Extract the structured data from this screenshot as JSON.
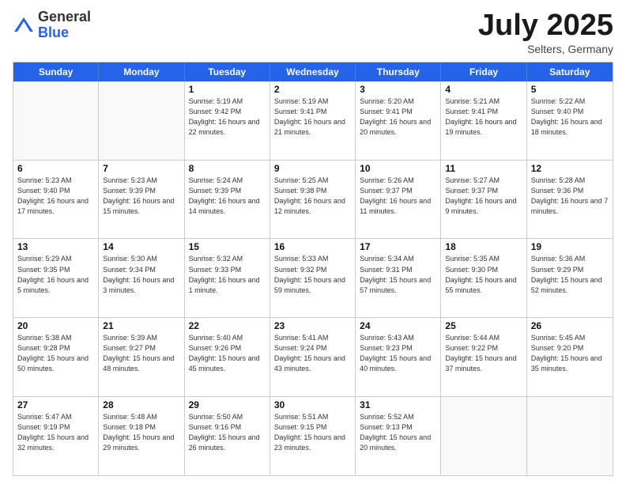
{
  "header": {
    "logo": {
      "general": "General",
      "blue": "Blue"
    },
    "title": "July 2025",
    "location": "Selters, Germany"
  },
  "days_of_week": [
    "Sunday",
    "Monday",
    "Tuesday",
    "Wednesday",
    "Thursday",
    "Friday",
    "Saturday"
  ],
  "weeks": [
    [
      {
        "day": null
      },
      {
        "day": null
      },
      {
        "day": "1",
        "sunrise": "5:19 AM",
        "sunset": "9:42 PM",
        "daylight": "16 hours and 22 minutes."
      },
      {
        "day": "2",
        "sunrise": "5:19 AM",
        "sunset": "9:41 PM",
        "daylight": "16 hours and 21 minutes."
      },
      {
        "day": "3",
        "sunrise": "5:20 AM",
        "sunset": "9:41 PM",
        "daylight": "16 hours and 20 minutes."
      },
      {
        "day": "4",
        "sunrise": "5:21 AM",
        "sunset": "9:41 PM",
        "daylight": "16 hours and 19 minutes."
      },
      {
        "day": "5",
        "sunrise": "5:22 AM",
        "sunset": "9:40 PM",
        "daylight": "16 hours and 18 minutes."
      }
    ],
    [
      {
        "day": "6",
        "sunrise": "5:23 AM",
        "sunset": "9:40 PM",
        "daylight": "16 hours and 17 minutes."
      },
      {
        "day": "7",
        "sunrise": "5:23 AM",
        "sunset": "9:39 PM",
        "daylight": "16 hours and 15 minutes."
      },
      {
        "day": "8",
        "sunrise": "5:24 AM",
        "sunset": "9:39 PM",
        "daylight": "16 hours and 14 minutes."
      },
      {
        "day": "9",
        "sunrise": "5:25 AM",
        "sunset": "9:38 PM",
        "daylight": "16 hours and 12 minutes."
      },
      {
        "day": "10",
        "sunrise": "5:26 AM",
        "sunset": "9:37 PM",
        "daylight": "16 hours and 11 minutes."
      },
      {
        "day": "11",
        "sunrise": "5:27 AM",
        "sunset": "9:37 PM",
        "daylight": "16 hours and 9 minutes."
      },
      {
        "day": "12",
        "sunrise": "5:28 AM",
        "sunset": "9:36 PM",
        "daylight": "16 hours and 7 minutes."
      }
    ],
    [
      {
        "day": "13",
        "sunrise": "5:29 AM",
        "sunset": "9:35 PM",
        "daylight": "16 hours and 5 minutes."
      },
      {
        "day": "14",
        "sunrise": "5:30 AM",
        "sunset": "9:34 PM",
        "daylight": "16 hours and 3 minutes."
      },
      {
        "day": "15",
        "sunrise": "5:32 AM",
        "sunset": "9:33 PM",
        "daylight": "16 hours and 1 minute."
      },
      {
        "day": "16",
        "sunrise": "5:33 AM",
        "sunset": "9:32 PM",
        "daylight": "15 hours and 59 minutes."
      },
      {
        "day": "17",
        "sunrise": "5:34 AM",
        "sunset": "9:31 PM",
        "daylight": "15 hours and 57 minutes."
      },
      {
        "day": "18",
        "sunrise": "5:35 AM",
        "sunset": "9:30 PM",
        "daylight": "15 hours and 55 minutes."
      },
      {
        "day": "19",
        "sunrise": "5:36 AM",
        "sunset": "9:29 PM",
        "daylight": "15 hours and 52 minutes."
      }
    ],
    [
      {
        "day": "20",
        "sunrise": "5:38 AM",
        "sunset": "9:28 PM",
        "daylight": "15 hours and 50 minutes."
      },
      {
        "day": "21",
        "sunrise": "5:39 AM",
        "sunset": "9:27 PM",
        "daylight": "15 hours and 48 minutes."
      },
      {
        "day": "22",
        "sunrise": "5:40 AM",
        "sunset": "9:26 PM",
        "daylight": "15 hours and 45 minutes."
      },
      {
        "day": "23",
        "sunrise": "5:41 AM",
        "sunset": "9:24 PM",
        "daylight": "15 hours and 43 minutes."
      },
      {
        "day": "24",
        "sunrise": "5:43 AM",
        "sunset": "9:23 PM",
        "daylight": "15 hours and 40 minutes."
      },
      {
        "day": "25",
        "sunrise": "5:44 AM",
        "sunset": "9:22 PM",
        "daylight": "15 hours and 37 minutes."
      },
      {
        "day": "26",
        "sunrise": "5:45 AM",
        "sunset": "9:20 PM",
        "daylight": "15 hours and 35 minutes."
      }
    ],
    [
      {
        "day": "27",
        "sunrise": "5:47 AM",
        "sunset": "9:19 PM",
        "daylight": "15 hours and 32 minutes."
      },
      {
        "day": "28",
        "sunrise": "5:48 AM",
        "sunset": "9:18 PM",
        "daylight": "15 hours and 29 minutes."
      },
      {
        "day": "29",
        "sunrise": "5:50 AM",
        "sunset": "9:16 PM",
        "daylight": "15 hours and 26 minutes."
      },
      {
        "day": "30",
        "sunrise": "5:51 AM",
        "sunset": "9:15 PM",
        "daylight": "15 hours and 23 minutes."
      },
      {
        "day": "31",
        "sunrise": "5:52 AM",
        "sunset": "9:13 PM",
        "daylight": "15 hours and 20 minutes."
      },
      {
        "day": null
      },
      {
        "day": null
      }
    ]
  ],
  "labels": {
    "sunrise_prefix": "Sunrise: ",
    "sunset_prefix": "Sunset: ",
    "daylight_prefix": "Daylight: "
  }
}
